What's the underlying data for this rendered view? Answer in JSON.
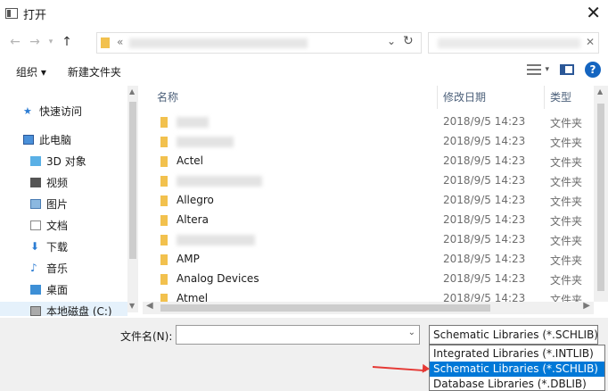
{
  "window": {
    "title": "打开",
    "close_icon": "close-icon"
  },
  "navbar": {
    "back_icon": "arrow-left-icon",
    "forward_icon": "arrow-right-icon",
    "recent_icon": "chevron-down-icon",
    "up_icon": "arrow-up-icon",
    "address_chevron": "«"
  },
  "toolbar": {
    "organize_label": "组织 ▾",
    "new_folder_label": "新建文件夹"
  },
  "sidebar": {
    "items": [
      {
        "label": "快速访问",
        "icon": "star-icon"
      },
      {
        "label": "此电脑",
        "icon": "computer-icon"
      },
      {
        "label": "3D 对象",
        "icon": "cube-icon"
      },
      {
        "label": "视频",
        "icon": "video-icon"
      },
      {
        "label": "图片",
        "icon": "picture-icon"
      },
      {
        "label": "文档",
        "icon": "document-icon"
      },
      {
        "label": "下载",
        "icon": "download-icon"
      },
      {
        "label": "音乐",
        "icon": "music-icon"
      },
      {
        "label": "桌面",
        "icon": "desktop-icon"
      },
      {
        "label": "本地磁盘 (C:)",
        "icon": "drive-icon"
      }
    ]
  },
  "columns": {
    "name": "名称",
    "date": "修改日期",
    "type": "类型"
  },
  "files": [
    {
      "name": "",
      "date": "2018/9/5 14:23",
      "type": "文件夹"
    },
    {
      "name": "",
      "date": "2018/9/5 14:23",
      "type": "文件夹"
    },
    {
      "name": "Actel",
      "date": "2018/9/5 14:23",
      "type": "文件夹"
    },
    {
      "name": "",
      "date": "2018/9/5 14:23",
      "type": "文件夹"
    },
    {
      "name": "Allegro",
      "date": "2018/9/5 14:23",
      "type": "文件夹"
    },
    {
      "name": "Altera",
      "date": "2018/9/5 14:23",
      "type": "文件夹"
    },
    {
      "name": "",
      "date": "2018/9/5 14:23",
      "type": "文件夹"
    },
    {
      "name": "AMP",
      "date": "2018/9/5 14:23",
      "type": "文件夹"
    },
    {
      "name": "Analog Devices",
      "date": "2018/9/5 14:23",
      "type": "文件夹"
    },
    {
      "name": "Atmel",
      "date": "2018/9/5 14:23",
      "type": "文件夹"
    }
  ],
  "bottom": {
    "filename_label": "文件名(N):",
    "filename_value": "",
    "filetype_selected": "Schematic Libraries (*.SCHLIB)",
    "filetype_options": [
      "Integrated Libraries (*.INTLIB)",
      "Schematic Libraries (*.SCHLIB)",
      "Database Libraries (*.DBLIB)"
    ],
    "selected_index": 1
  },
  "colors": {
    "accent": "#0078d7",
    "folder": "#f2c14e",
    "annotation_arrow": "#e53935",
    "help": "#1565c0"
  }
}
